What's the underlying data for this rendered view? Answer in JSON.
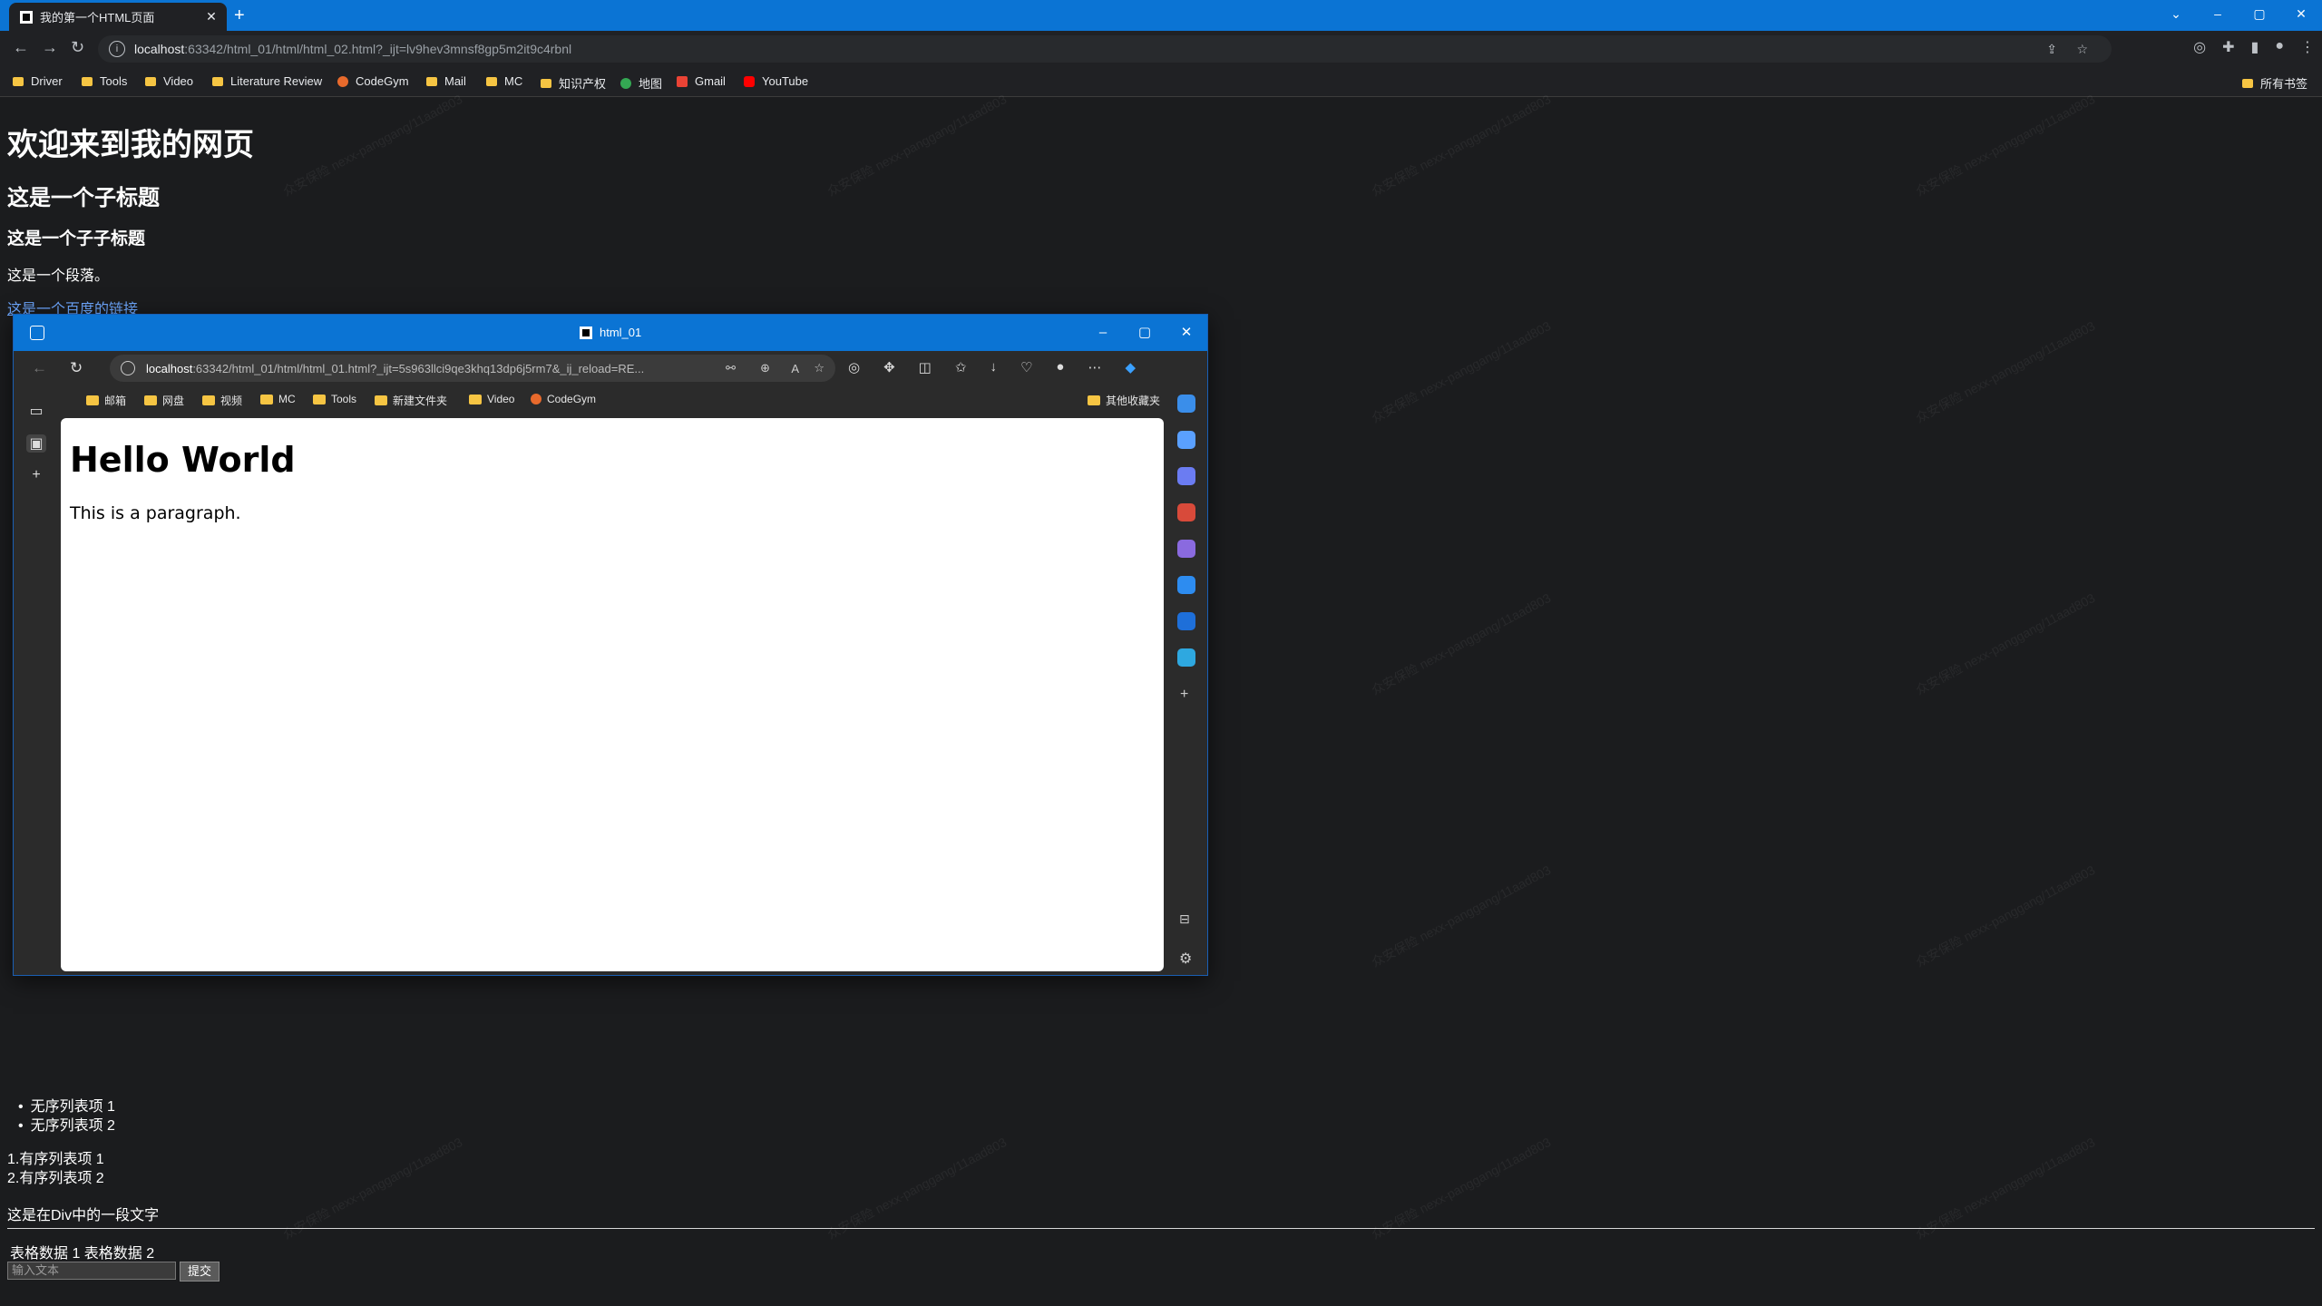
{
  "outer_browser": {
    "tab_title": "我的第一个HTML页面",
    "close_glyph": "✕",
    "new_tab_glyph": "+",
    "url_host": "localhost",
    "url_rest": ":63342/html_01/html/html_02.html?_ijt=lv9hev3mnsf8gp5m2it9c4rbnl",
    "window_controls": [
      "⌄",
      "–",
      "▢",
      "✕"
    ],
    "bookmarks": [
      {
        "label": "Driver",
        "icon": "folder-icon"
      },
      {
        "label": "Tools",
        "icon": "folder-icon"
      },
      {
        "label": "Video",
        "icon": "folder-icon"
      },
      {
        "label": "Literature Review",
        "icon": "folder-icon"
      },
      {
        "label": "CodeGym",
        "icon": "codegym-icon"
      },
      {
        "label": "Mail",
        "icon": "folder-icon"
      },
      {
        "label": "MC",
        "icon": "folder-icon"
      },
      {
        "label": "知识产权",
        "icon": "folder-icon"
      },
      {
        "label": "地图",
        "icon": "maps-icon"
      },
      {
        "label": "Gmail",
        "icon": "gmail-icon"
      },
      {
        "label": "YouTube",
        "icon": "youtube-icon"
      }
    ],
    "all_bookmarks": "所有书签"
  },
  "page": {
    "h1": "欢迎来到我的网页",
    "h2": "这是一个子标题",
    "h3": "这是一个子子标题",
    "paragraph": "这是一个段落。",
    "link": "这是一个百度的链接",
    "unordered_list": [
      "无序列表项 1",
      "无序列表项 2"
    ],
    "ordered_list": [
      "1.有序列表项 1",
      "2.有序列表项 2"
    ],
    "div_text": "这是在Div中的一段文字",
    "table_row": "表格数据 1 表格数据 2",
    "input_placeholder": "输入文本",
    "submit_label": "提交",
    "bullet": "•"
  },
  "inner_browser": {
    "title": "html_01",
    "url_host": "localhost",
    "url_rest": ":63342/html_01/html/html_01.html?_ijt=5s963llci9qe3khq13dp6j5rm7&_ij_reload=RE...",
    "bookmarks": [
      {
        "label": "邮箱"
      },
      {
        "label": "网盘"
      },
      {
        "label": "视频"
      },
      {
        "label": "MC"
      },
      {
        "label": "Tools"
      },
      {
        "label": "新建文件夹"
      },
      {
        "label": "Video"
      },
      {
        "label": "CodeGym"
      }
    ],
    "other_favorites": "其他收藏夹",
    "content_h1": "Hello World",
    "content_p": "This is a paragraph."
  },
  "colors": {
    "titlebar": "#0b74d4",
    "page_bg": "#1b1c1e",
    "link": "#6ea8ff"
  }
}
